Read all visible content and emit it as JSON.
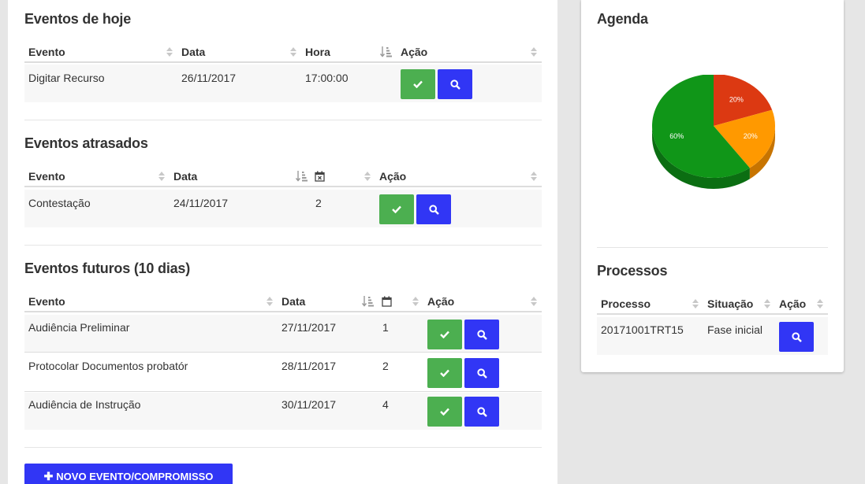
{
  "today": {
    "title": "Eventos de hoje",
    "headers": {
      "evento": "Evento",
      "data": "Data",
      "hora": "Hora",
      "acao": "Ação"
    },
    "rows": [
      {
        "evento": "Digitar Recurso",
        "data": "26/11/2017",
        "hora": "17:00:00"
      }
    ]
  },
  "late": {
    "title": "Eventos atrasados",
    "headers": {
      "evento": "Evento",
      "data": "Data",
      "acao": "Ação"
    },
    "rows": [
      {
        "evento": "Contestação",
        "data": "24/11/2017",
        "dias": "2"
      }
    ]
  },
  "future": {
    "title": "Eventos futuros (10 dias)",
    "headers": {
      "evento": "Evento",
      "data": "Data",
      "acao": "Ação"
    },
    "rows": [
      {
        "evento": "Audiência Preliminar",
        "data": "27/11/2017",
        "dias": "1"
      },
      {
        "evento": "Protocolar Documentos probatór",
        "data": "28/11/2017",
        "dias": "2"
      },
      {
        "evento": "Audiência de Instrução",
        "data": "30/11/2017",
        "dias": "4"
      }
    ]
  },
  "new_event_label": "NOVO EVENTO/COMPROMISSO",
  "agenda": {
    "title": "Agenda",
    "chart_data": {
      "type": "pie",
      "values": [
        20,
        20,
        60
      ],
      "labels": [
        "20%",
        "20%",
        "60%"
      ],
      "colors": [
        "#dc3912",
        "#ff9900",
        "#109618"
      ],
      "shadow_colors": [
        "#a52a0b",
        "#c77400",
        "#0b6e12"
      ]
    }
  },
  "processos": {
    "title": "Processos",
    "headers": {
      "processo": "Processo",
      "situacao": "Situação",
      "acao": "Ação"
    },
    "rows": [
      {
        "processo": "20171001TRT15",
        "situacao": "Fase inicial"
      }
    ]
  },
  "colors": {
    "accent": "#3136f5",
    "success": "#4caf50"
  }
}
